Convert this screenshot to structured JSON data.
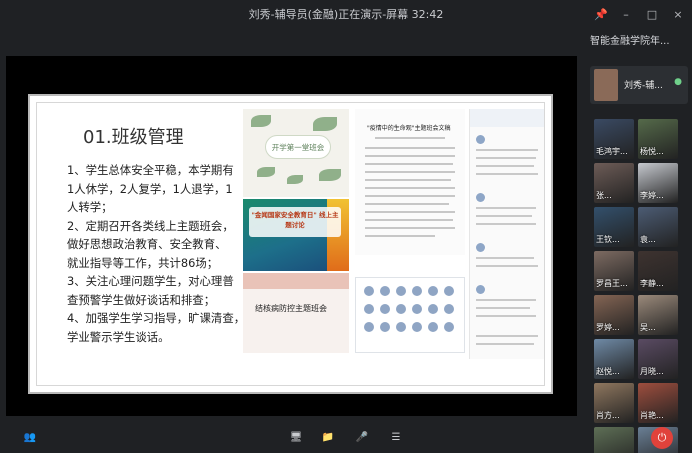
{
  "header": {
    "title": "刘秀-辅导员(金融)正在演示-屏幕 32:42"
  },
  "window_controls": {
    "pin_icon": "📌",
    "minimize": "–",
    "maximize": "□",
    "close": "×"
  },
  "slide": {
    "title": "01.班级管理",
    "lines": [
      "1、学生总体安全平稳，本学期有",
      "1人休学，2人复学，1人退学，1",
      "人转学；",
      "2、定期召开各类线上主题班会，",
      "做好思想政治教育、安全教育、",
      "就业指导等工作，共计86场；",
      "3、关注心理问题学生，对心理普",
      "查预警学生做好谈话和排查；",
      "4、加强学生学习指导，旷课清查，",
      "学业警示学生谈话。"
    ],
    "photos": {
      "p1": "开学第一堂班会",
      "p2": "\"金闻国家安全教育日\" 线上主题讨论",
      "p3": "结核病防控主题班会",
      "p4": "\"疫情中的生命观\"主题班会文稿"
    }
  },
  "panel": {
    "title": "智能金融学院年...",
    "presenter_name": "刘秀-辅...",
    "participants": [
      {
        "name": "毛鸿宇...",
        "color": "#3a4a63"
      },
      {
        "name": "杨悦...",
        "color": "#556a4a"
      },
      {
        "name": "张...",
        "color": "#6d5c57"
      },
      {
        "name": "李婷...",
        "color": "#c6c9cf"
      },
      {
        "name": "王钦...",
        "color": "#33506c"
      },
      {
        "name": "袁...",
        "color": "#4c5c74"
      },
      {
        "name": "罗昌王...",
        "color": "#7d6b62"
      },
      {
        "name": "李静...",
        "color": "#3e3330"
      },
      {
        "name": "罗婷...",
        "color": "#846554"
      },
      {
        "name": "吴...",
        "color": "#9b8a7b"
      },
      {
        "name": "赵悦...",
        "color": "#6f8aa6"
      },
      {
        "name": "月晓...",
        "color": "#5a4b63"
      },
      {
        "name": "肖方...",
        "color": "#8f775f"
      },
      {
        "name": "肖艳...",
        "color": "#9e4e3e"
      },
      {
        "name": "叶...",
        "color": "#5e6f56"
      },
      {
        "name": "王...",
        "color": "#6a7f95"
      }
    ]
  },
  "toolbar": {
    "participants_icon": "👥",
    "share_icon": "🖥",
    "folder_icon": "📁",
    "mic_icon": "🎤",
    "menu_icon": "☰",
    "end_icon": "⏻"
  }
}
